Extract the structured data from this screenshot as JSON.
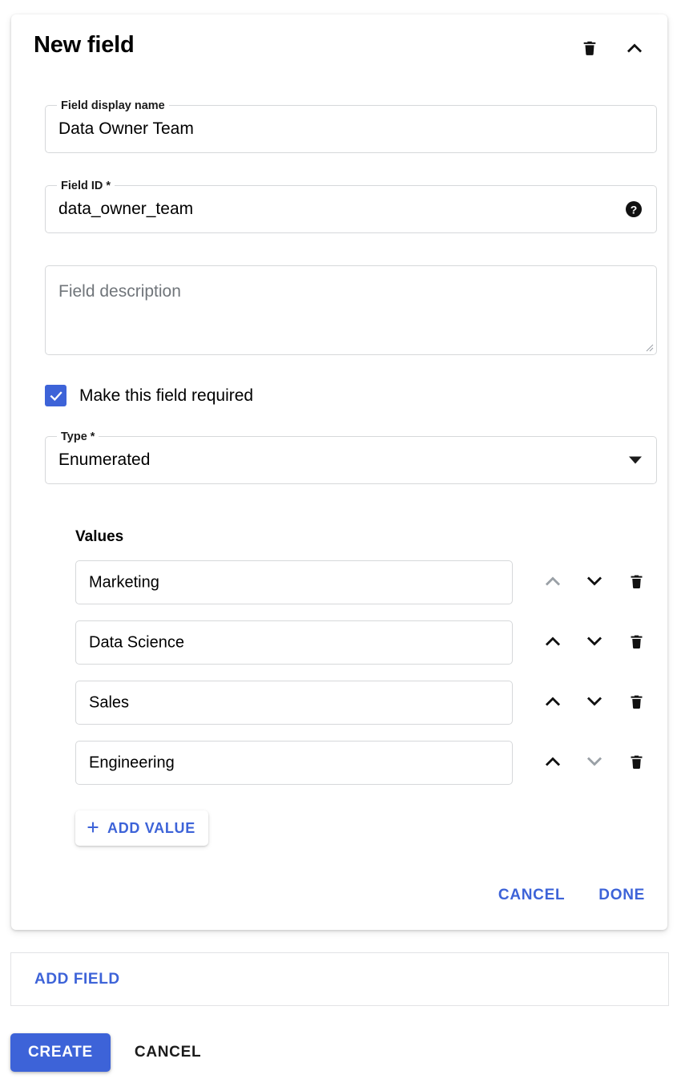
{
  "card": {
    "title": "New field",
    "delete_icon": "trash-icon",
    "collapse_icon": "chevron-up-icon"
  },
  "display_name": {
    "label": "Field display name",
    "value": "Data Owner Team",
    "placeholder": "Field display name"
  },
  "field_id": {
    "label": "Field ID *",
    "value": "data_owner_team",
    "placeholder": "Field ID",
    "help_icon": "help-icon"
  },
  "description": {
    "placeholder": "Field description",
    "value": ""
  },
  "required": {
    "label": "Make this field required",
    "checked": true
  },
  "type": {
    "label": "Type *",
    "value": "Enumerated",
    "caret_icon": "chevron-down-icon"
  },
  "values": {
    "label": "Values",
    "rows": [
      {
        "value": "Marketing",
        "move_up_enabled": false,
        "move_down_enabled": true
      },
      {
        "value": "Data Science",
        "move_up_enabled": true,
        "move_down_enabled": true
      },
      {
        "value": "Sales",
        "move_up_enabled": true,
        "move_down_enabled": true
      },
      {
        "value": "Engineering",
        "move_up_enabled": true,
        "move_down_enabled": false
      }
    ],
    "add_value_label": "ADD VALUE",
    "add_icon": "plus-icon"
  },
  "card_footer": {
    "cancel_label": "CANCEL",
    "done_label": "DONE"
  },
  "add_field": {
    "label": "ADD FIELD"
  },
  "bottom_bar": {
    "create_label": "CREATE",
    "cancel_label": "CANCEL"
  },
  "colors": {
    "accent": "#3d63d8",
    "text": "#000000",
    "muted_text": "#70757a",
    "border": "#d6d8da",
    "disabled_icon": "#9aa0a6",
    "enabled_icon": "#111111"
  }
}
